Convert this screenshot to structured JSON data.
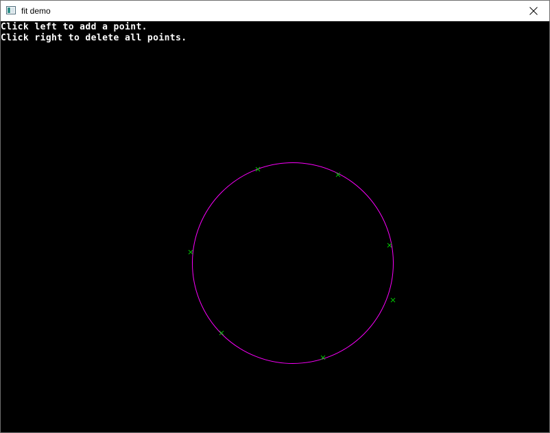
{
  "window": {
    "title": "fit demo",
    "icons": {
      "app": "app-window-icon",
      "close": "close-icon"
    }
  },
  "instructions": {
    "line1": "Click left to add a point.",
    "line2": "Click right to delete all points."
  },
  "colors": {
    "canvas_background": "#000000",
    "instruction_text": "#ffffff",
    "fitted_circle": "#ff00ff",
    "point_marker": "#00c800"
  }
}
